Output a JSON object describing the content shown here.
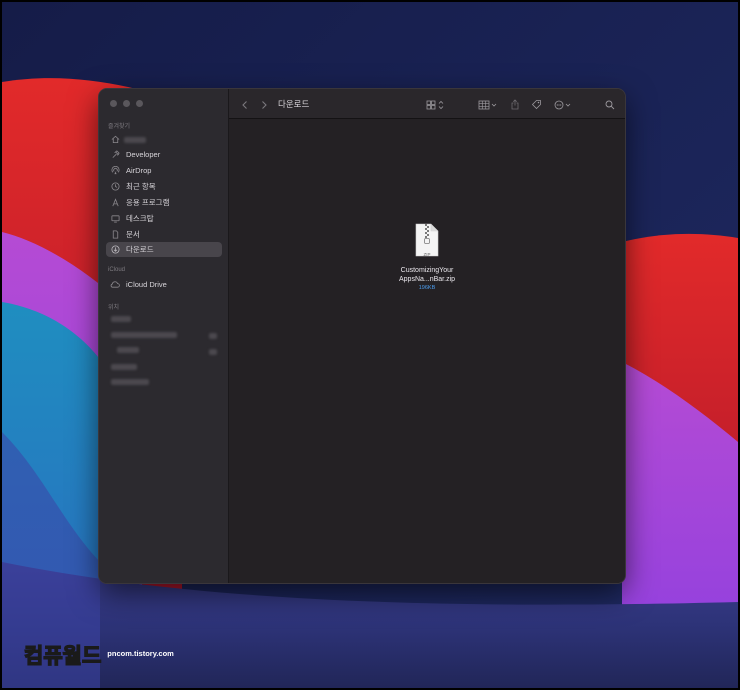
{
  "window": {
    "title": "다운로드",
    "traffic_lights": [
      "close",
      "minimize",
      "zoom"
    ]
  },
  "toolbar": {
    "back": "chevron-left-icon",
    "forward": "chevron-right-icon",
    "buttons": [
      "view-icons-icon",
      "group-grid-icon",
      "share-icon",
      "tag-icon",
      "more-options-icon",
      "search-icon"
    ]
  },
  "sidebar": {
    "favorites_header": "즐겨찾기",
    "favorites": [
      {
        "label": "Developer",
        "icon": "hammer-icon"
      },
      {
        "label": "AirDrop",
        "icon": "airdrop-icon"
      },
      {
        "label": "최근 항목",
        "icon": "clock-icon"
      },
      {
        "label": "응용 프로그램",
        "icon": "applications-icon"
      },
      {
        "label": "데스크탑",
        "icon": "desktop-icon"
      },
      {
        "label": "문서",
        "icon": "document-icon"
      },
      {
        "label": "다운로드",
        "icon": "download-icon",
        "selected": true
      }
    ],
    "icloud_header": "iCloud",
    "icloud": [
      {
        "label": "iCloud Drive",
        "icon": "cloud-icon"
      }
    ],
    "locations_header": "위치"
  },
  "content": {
    "file": {
      "name_line1": "CustomizingYour",
      "name_line2": "AppsNa...nBar.zip",
      "size": "196KB",
      "type_label": "ZIP"
    }
  },
  "watermark": {
    "logo_a": "컴퓨",
    "logo_b": "월드",
    "url": "pncom.tistory.com"
  },
  "colors": {
    "accent": "#4c9ef0",
    "selection": "#48454b",
    "watermark_gold": "#ffc21a"
  }
}
